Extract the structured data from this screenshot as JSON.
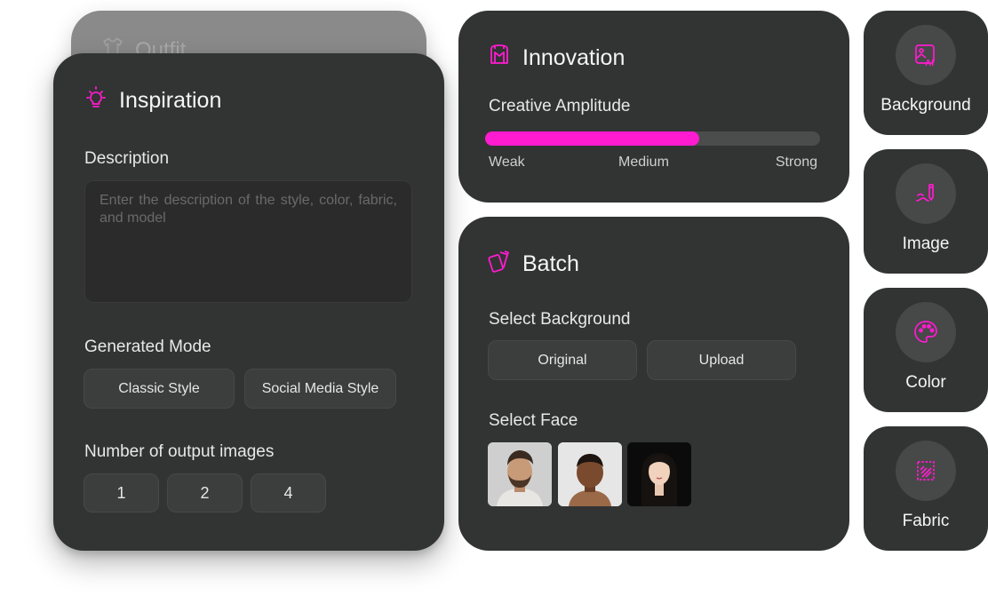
{
  "colors": {
    "accent": "#ff1bd0",
    "card": "#323333",
    "button": "#3c3d3d"
  },
  "outfit": {
    "title": "Outfit",
    "icon": "shirt-icon"
  },
  "inspiration": {
    "title": "Inspiration",
    "icon": "lightbulb-icon",
    "description_label": "Description",
    "description_placeholder": "Enter the description of the style, color, fabric, and model",
    "mode_label": "Generated Mode",
    "modes": [
      "Classic Style",
      "Social Media Style"
    ],
    "count_label": "Number of output images",
    "counts": [
      "1",
      "2",
      "4"
    ]
  },
  "innovation": {
    "title": "Innovation",
    "icon": "mannequin-icon",
    "amplitude_label": "Creative Amplitude",
    "amplitude_value": 0.64,
    "ticks": [
      "Weak",
      "Medium",
      "Strong"
    ]
  },
  "batch": {
    "title": "Batch",
    "icon": "cards-icon",
    "background_label": "Select Background",
    "background_options": [
      "Original",
      "Upload"
    ],
    "face_label": "Select Face",
    "faces": [
      "face-man-beard",
      "face-child",
      "face-woman"
    ]
  },
  "tiles": [
    {
      "label": "Background",
      "icon": "ai-image-icon"
    },
    {
      "label": "Image",
      "icon": "pen-icon"
    },
    {
      "label": "Color",
      "icon": "palette-icon"
    },
    {
      "label": "Fabric",
      "icon": "fabric-icon"
    }
  ]
}
